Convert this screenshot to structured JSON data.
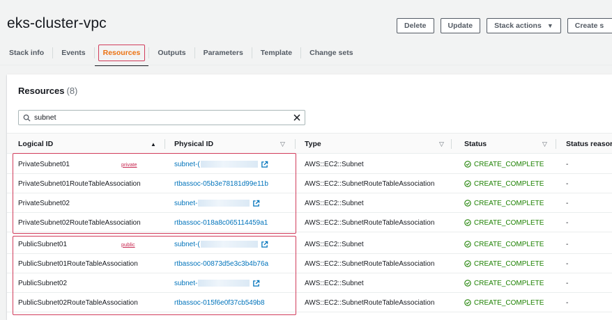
{
  "stack": {
    "title": "eks-cluster-vpc"
  },
  "actions": {
    "delete_label": "Delete",
    "update_label": "Update",
    "stack_actions_label": "Stack actions",
    "create_label": "Create s"
  },
  "tabs": [
    {
      "label": "Stack info"
    },
    {
      "label": "Events"
    },
    {
      "label": "Resources"
    },
    {
      "label": "Outputs"
    },
    {
      "label": "Parameters"
    },
    {
      "label": "Template"
    },
    {
      "label": "Change sets"
    }
  ],
  "active_tab": "Resources",
  "resources": {
    "title": "Resources",
    "count": "(8)",
    "search_value": "subnet",
    "columns": {
      "logical_id": "Logical ID",
      "physical_id": "Physical ID",
      "type": "Type",
      "status": "Status",
      "status_reason": "Status reasor"
    },
    "rows": [
      {
        "logical_id": "PrivateSubnet01",
        "tag": "private",
        "physical_id": "subnet-(",
        "redacted": true,
        "type": "AWS::EC2::Subnet",
        "status": "CREATE_COMPLETE",
        "reason": "-"
      },
      {
        "logical_id": "PrivateSubnet01RouteTableAssociation",
        "tag": "",
        "physical_id": "rtbassoc-05b3e78181d99e11b",
        "redacted": false,
        "type": "AWS::EC2::SubnetRouteTableAssociation",
        "status": "CREATE_COMPLETE",
        "reason": "-"
      },
      {
        "logical_id": "PrivateSubnet02",
        "tag": "",
        "physical_id": "subnet-",
        "redacted": true,
        "type": "AWS::EC2::Subnet",
        "status": "CREATE_COMPLETE",
        "reason": "-"
      },
      {
        "logical_id": "PrivateSubnet02RouteTableAssociation",
        "tag": "",
        "physical_id": "rtbassoc-018a8c065114459a1",
        "redacted": false,
        "type": "AWS::EC2::SubnetRouteTableAssociation",
        "status": "CREATE_COMPLETE",
        "reason": "-"
      },
      {
        "logical_id": "PublicSubnet01",
        "tag": "public",
        "physical_id": "subnet-(",
        "redacted": true,
        "type": "AWS::EC2::Subnet",
        "status": "CREATE_COMPLETE",
        "reason": "-"
      },
      {
        "logical_id": "PublicSubnet01RouteTableAssociation",
        "tag": "",
        "physical_id": "rtbassoc-00873d5e3c3b4b76a",
        "redacted": false,
        "type": "AWS::EC2::SubnetRouteTableAssociation",
        "status": "CREATE_COMPLETE",
        "reason": "-"
      },
      {
        "logical_id": "PublicSubnet02",
        "tag": "",
        "physical_id": "subnet-",
        "redacted": true,
        "type": "AWS::EC2::Subnet",
        "status": "CREATE_COMPLETE",
        "reason": "-"
      },
      {
        "logical_id": "PublicSubnet02RouteTableAssociation",
        "tag": "",
        "physical_id": "rtbassoc-015f6e0f37cb549b8",
        "redacted": false,
        "type": "AWS::EC2::SubnetRouteTableAssociation",
        "status": "CREATE_COMPLETE",
        "reason": "-"
      }
    ]
  },
  "colors": {
    "accent_active_tab": "#ec7211",
    "highlight_box": "#d13c5b",
    "link": "#0073bb",
    "success": "#1d8102"
  }
}
